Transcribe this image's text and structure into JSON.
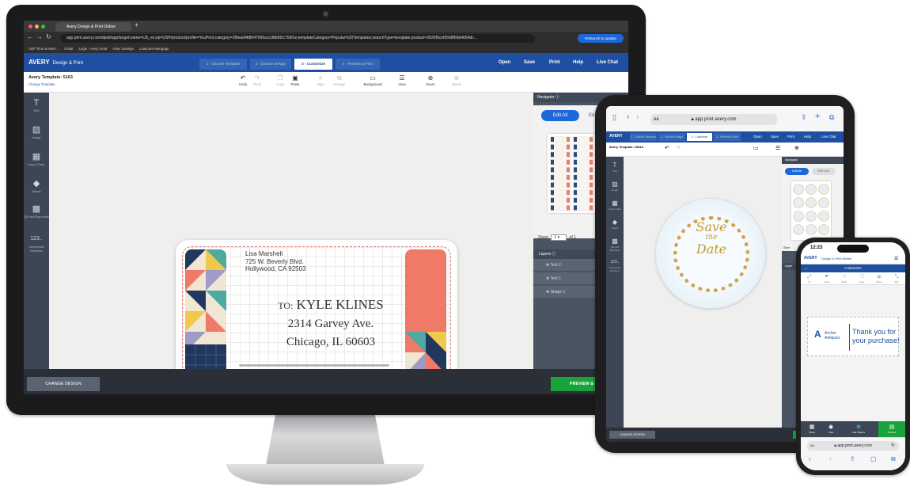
{
  "imac": {
    "browser": {
      "tab_title": "Avery Design & Print Online",
      "url": "app.print.avery.com/dpoll/app/target;name=US_en;ep=USP/product/profile=YouPrint;category=3f9ea04fdf047690a1c98b81fc756f1e;templateCategory=Popular%20Templates;searchType=template;product=2626f5cef2668f66b4064dc...",
      "relaunch": "Relaunch to update",
      "bookmarks": [
        "ADP Time & Atten...",
        "Gmail",
        "Login - Avery DAM",
        "Artex Savings",
        "Loancare-Mortgage"
      ]
    },
    "header": {
      "logo": "AVERY",
      "logo_sub": "Design & Print",
      "steps": [
        "1 - Choose Template",
        "2 - Choose Design",
        "3 - Customize",
        "4 - Preview & Print"
      ],
      "active_step": 2,
      "nav": [
        "Open",
        "Save",
        "Print",
        "Help",
        "Live Chat"
      ]
    },
    "toolbar": {
      "template": "Avery Template: 5163",
      "change_template": "Change Template",
      "tools": [
        {
          "label": "Undo",
          "icon": "undo-icon",
          "enabled": true
        },
        {
          "label": "Redo",
          "icon": "redo-icon",
          "enabled": false
        },
        {
          "label": "Copy",
          "icon": "copy-icon",
          "enabled": false
        },
        {
          "label": "Paste",
          "icon": "paste-icon",
          "enabled": true
        },
        {
          "label": "Align",
          "icon": "align-icon",
          "enabled": false
        },
        {
          "label": "Arrange",
          "icon": "arrange-icon",
          "enabled": false
        },
        {
          "label": "Background",
          "icon": "background-icon",
          "enabled": true
        },
        {
          "label": "View",
          "icon": "view-icon",
          "enabled": true
        },
        {
          "label": "Zoom",
          "icon": "zoom-icon",
          "enabled": true
        },
        {
          "label": "Delete",
          "icon": "delete-icon",
          "enabled": false
        }
      ]
    },
    "sidebar": [
      {
        "label": "Text",
        "icon": "text-icon"
      },
      {
        "label": "Image",
        "icon": "image-icon"
      },
      {
        "label": "Import Data",
        "icon": "import-data-icon"
      },
      {
        "label": "Shape",
        "icon": "shape-icon"
      },
      {
        "label": "QR and Barcodes",
        "icon": "qr-icon"
      },
      {
        "label": "Sequential Numbers",
        "icon": "sequential-numbers-icon",
        "glyph": "123.."
      }
    ],
    "label": {
      "return_address": [
        "Lisa Marshell",
        "725 W. Beverly Blvd.",
        "Hollywood, CA 92503"
      ],
      "to_prefix": "TO:",
      "to_name": "KYLE KLINES",
      "street": "2314 Garvey Ave.",
      "city": "Chicago, IL 60603"
    },
    "navigator": {
      "title": "Navigator",
      "edit_all": "Edit All",
      "edit_one": "Ed",
      "sheet_label": "Sheet",
      "sheet_value": "1",
      "sheet_of": "of 1"
    },
    "layers": {
      "title": "Layers",
      "items": [
        "Text 2",
        "Text 1",
        "Shape 1"
      ]
    },
    "footer": {
      "change_design": "CHANGE DESIGN",
      "preview": "PREVIEW & P"
    }
  },
  "ipad": {
    "url": "app.print.avery.com",
    "url_prefix": "AA",
    "header_steps": [
      "1 - Choose Template",
      "2 - Choose Design",
      "3 - Customize",
      "4 - Preview & Print"
    ],
    "header_nav": [
      "Open",
      "Save",
      "Print",
      "Help",
      "Live Chat"
    ],
    "template": "Avery Template: 22816",
    "design_text": [
      "Save",
      "the",
      "Date"
    ],
    "navigator": "Navigator",
    "edit_all": "Edit All",
    "edit_one": "Edit One",
    "sheet": "Shee",
    "layers": "Layer",
    "change_design": "CHANGE DESIGN"
  },
  "iphone": {
    "time": "12:23",
    "app_title": "Design & Print Mobile",
    "logo": "AVERY",
    "page_title": "Customize",
    "tools": [
      "Fit",
      "Undo",
      "Redo",
      "Copy",
      "Paste",
      "Edit"
    ],
    "brand": "Archer Antiques",
    "card_text": "Thank you for your purchase!",
    "bottom": [
      "Sheet",
      "View",
      "Add Objects",
      "Preview"
    ],
    "url": "app.print.avery.com",
    "url_prefix": "AA"
  },
  "colors": {
    "avery_blue": "#1f4fa0",
    "accent_blue": "#1c68d8",
    "sidebar": "#3c4654",
    "green": "#19a33a",
    "coral": "#ee7a67",
    "navy": "#22375e",
    "teal": "#4ea9a1",
    "gold": "#c89a2e"
  }
}
